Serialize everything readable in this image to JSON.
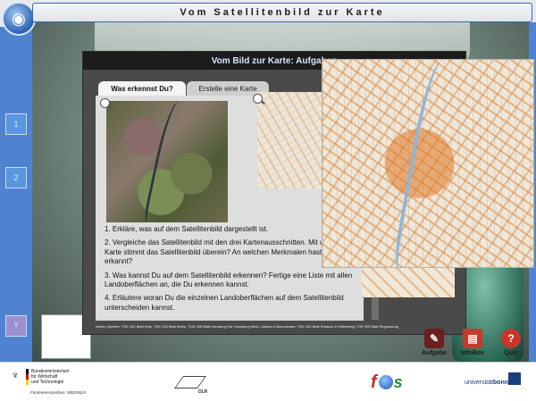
{
  "app": {
    "title": "Vom Satellitenbild zur Karte"
  },
  "sidebar": {
    "buttons": [
      {
        "label": "1"
      },
      {
        "label": "2"
      },
      {
        "label": "T"
      }
    ]
  },
  "panel": {
    "title": "Vom Bild zur Karte: Aufgaben",
    "tabs": [
      {
        "label": "Was erkennst Du?",
        "active": true
      },
      {
        "label": "Erstelle eine Karte",
        "active": false
      }
    ],
    "tasks": [
      "1. Erkläre, was auf dem Satellitenbild dargestellt ist.",
      "2. Vergleiche das Satellitenbild mit den drei Kartenausschnitten. Mit welcher Karte stimmt das Satellitenbild überein? An welchen Merkmalen hast Du das erkannt?",
      "3. Was kannst Du auf dem Satellitenbild erkennen? Fertige eine Liste mit allen Landoberflächen an, die Du erkennen kannst.",
      "4. Erläutere woran Du die einzelnen Landoberflächen auf dem Satellitenbild unterscheiden kannst."
    ],
    "source": "Karten Quellen: TÜK 200 Blatt Köln, TÜK 200 Blatt Berlin, TÜK 200 Blatt Hamburg Ost, Hamburg West, Lübeck & Neumünster, TÜK 200 Blatt Rostock & Wittenberg TÜK 200 Blatt Regensburg"
  },
  "actions": {
    "aufgabe": {
      "label": "Aufgabe"
    },
    "infobox": {
      "label": "InfoBox"
    },
    "quiz": {
      "label": "Quiz",
      "icon": "question-icon"
    }
  },
  "footer": {
    "bmwi_line1": "Bundesministerium",
    "bmwi_line2": "für Wirtschaft",
    "bmwi_line3": "und Technologie",
    "foerder": "Förderkennzeichen: 50EE0615",
    "dlr": "DLR",
    "fis_f": "f",
    "fis_s": "s",
    "bonn_prefix": "universität",
    "bonn_suffix": "bonn"
  },
  "colors": {
    "accent": "#4f83cf",
    "panel_header": "#1c1c1c",
    "map_roads": "#e0802a"
  }
}
